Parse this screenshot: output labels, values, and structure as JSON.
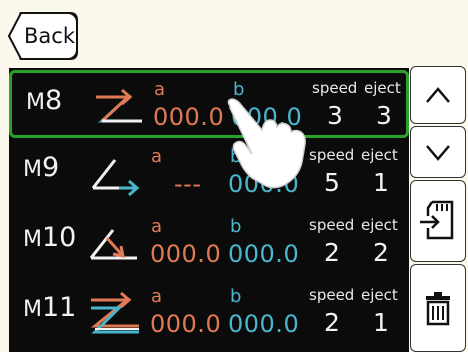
{
  "header": {
    "back_label": "Back"
  },
  "list": {
    "rows": [
      {
        "id": "M8",
        "prefix": "M",
        "num": "8",
        "a_label": "a",
        "b_label": "b",
        "a_value": "000.0",
        "b_value": "000.0",
        "speed_label": "speed",
        "eject_label": "eject",
        "speed": "3",
        "eject": "3",
        "selected": true
      },
      {
        "id": "M9",
        "prefix": "M",
        "num": "9",
        "a_label": "a",
        "b_label": "b",
        "a_value": "---",
        "b_value": "000.0",
        "speed_label": "speed",
        "eject_label": "eject",
        "speed": "5",
        "eject": "1",
        "selected": false
      },
      {
        "id": "M10",
        "prefix": "M",
        "num": "10",
        "a_label": "a",
        "b_label": "b",
        "a_value": "000.0",
        "b_value": "000.0",
        "speed_label": "speed",
        "eject_label": "eject",
        "speed": "2",
        "eject": "2",
        "selected": false
      },
      {
        "id": "M11",
        "prefix": "M",
        "num": "11",
        "a_label": "a",
        "b_label": "b",
        "a_value": "000.0",
        "b_value": "000.0",
        "speed_label": "speed",
        "eject_label": "eject",
        "speed": "2",
        "eject": "1",
        "selected": false
      }
    ]
  },
  "sidebar": {
    "buttons": [
      {
        "name": "scroll-up-button",
        "icon": "chevron-up-icon"
      },
      {
        "name": "scroll-down-button",
        "icon": "chevron-down-icon"
      },
      {
        "name": "import-button",
        "icon": "sd-card-import-icon"
      },
      {
        "name": "delete-button",
        "icon": "trash-icon"
      }
    ]
  },
  "colors": {
    "background": "#fbf8ec",
    "list_bg": "#0b0b0b",
    "selected_border": "#2aa12a",
    "a_color": "#e07a55",
    "b_color": "#4ab6cc"
  }
}
